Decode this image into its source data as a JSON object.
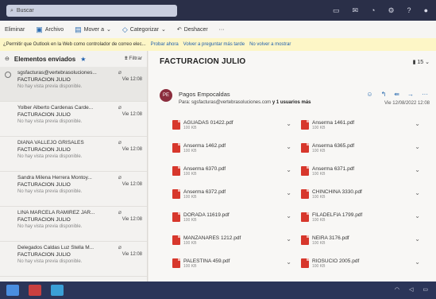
{
  "topbar": {
    "search_placeholder": "Buscar",
    "icons": [
      "video-icon",
      "mail-icon",
      "bell-icon",
      "gear-icon",
      "help-icon",
      "avatar-icon"
    ]
  },
  "toolbar": {
    "delete": "Eliminar",
    "archive": "Archivo",
    "move": "Mover a",
    "categorize": "Categorizar",
    "undo": "Deshacer",
    "more": "···"
  },
  "notice": {
    "text": "¿Permitir que Outlook en la Web como controlador de correo elec...",
    "try_now": "Probar ahora",
    "ask_later": "Volver a preguntar más tarde",
    "never": "No volver a mostrar"
  },
  "list": {
    "folder_title": "Elementos enviados",
    "filter": "Filtrar",
    "messages": [
      {
        "sender": "sgsfacturas@vertebrasoluciones...",
        "subject": "FACTURACION JULIO",
        "date": "Vie 12:08",
        "preview": "No hay vista previa disponible."
      },
      {
        "sender": "Yolber Alberto Cardenas Carde...",
        "subject": "FACTURACION JULIO",
        "date": "Vie 12:08",
        "preview": "No hay vista previa disponible."
      },
      {
        "sender": "DIANA VALLEJO GRISALES",
        "subject": "FACTURACION JULIO",
        "date": "Vie 12:08",
        "preview": "No hay vista previa disponible."
      },
      {
        "sender": "Sandra Milena Herrera Montoy...",
        "subject": "FACTURACION JULIO",
        "date": "Vie 12:08",
        "preview": "No hay vista previa disponible."
      },
      {
        "sender": "LINA MARCELA RAMIREZ JAR...",
        "subject": "FACTURACION JULIO",
        "date": "Vie 12:08",
        "preview": "No hay vista previa disponible."
      },
      {
        "sender": "Delegados Caldas Luz Stella M...",
        "subject": "FACTURACION JULIO",
        "date": "Vie 12:08",
        "preview": "No hay vista previa disponible."
      }
    ]
  },
  "reading": {
    "subject": "FACTURACION JULIO",
    "count": "15",
    "avatar_initials": "PE",
    "from": "Pagos Empocaldas",
    "to_label": "Para:",
    "to": "sgsfacturas@vertebrasoluciones.com",
    "more": "y 1 usuarios más",
    "date": "Vie 12/08/2022 12:08",
    "attachments": [
      {
        "name": "AGUADAS 01422.pdf",
        "size": "100 KB"
      },
      {
        "name": "Anserma 1461.pdf",
        "size": "100 KB"
      },
      {
        "name": "Anserma 1462.pdf",
        "size": "100 KB"
      },
      {
        "name": "Anserma 6365.pdf",
        "size": "100 KB"
      },
      {
        "name": "Anserma 6370.pdf",
        "size": "100 KB"
      },
      {
        "name": "Anserma 6371.pdf",
        "size": "100 KB"
      },
      {
        "name": "Anserma 6372.pdf",
        "size": "100 KB"
      },
      {
        "name": "CHINCHINA 3330.pdf",
        "size": "100 KB"
      },
      {
        "name": "DORADA 11619.pdf",
        "size": "100 KB"
      },
      {
        "name": "FILADELFIA 1799.pdf",
        "size": "100 KB"
      },
      {
        "name": "MANZANARES 1212.pdf",
        "size": "100 KB"
      },
      {
        "name": "NEIRA 3176.pdf",
        "size": "100 KB"
      },
      {
        "name": "PALESTINA 459.pdf",
        "size": "100 KB"
      },
      {
        "name": "RIOSUCIO 2005.pdf",
        "size": "100 KB"
      }
    ]
  },
  "taskbar": {
    "buttons": [
      {
        "icon": "windows-icon",
        "color": "#4a8ee0"
      },
      {
        "icon": "taskview-icon",
        "color": "#c94040"
      },
      {
        "icon": "edge-icon",
        "color": "#3a9fd6"
      }
    ]
  },
  "colors": {
    "topbar": "#2a2f48",
    "accent": "#1f5fad",
    "pdf": "#d7372c",
    "avatar": "#8b2d3d"
  }
}
